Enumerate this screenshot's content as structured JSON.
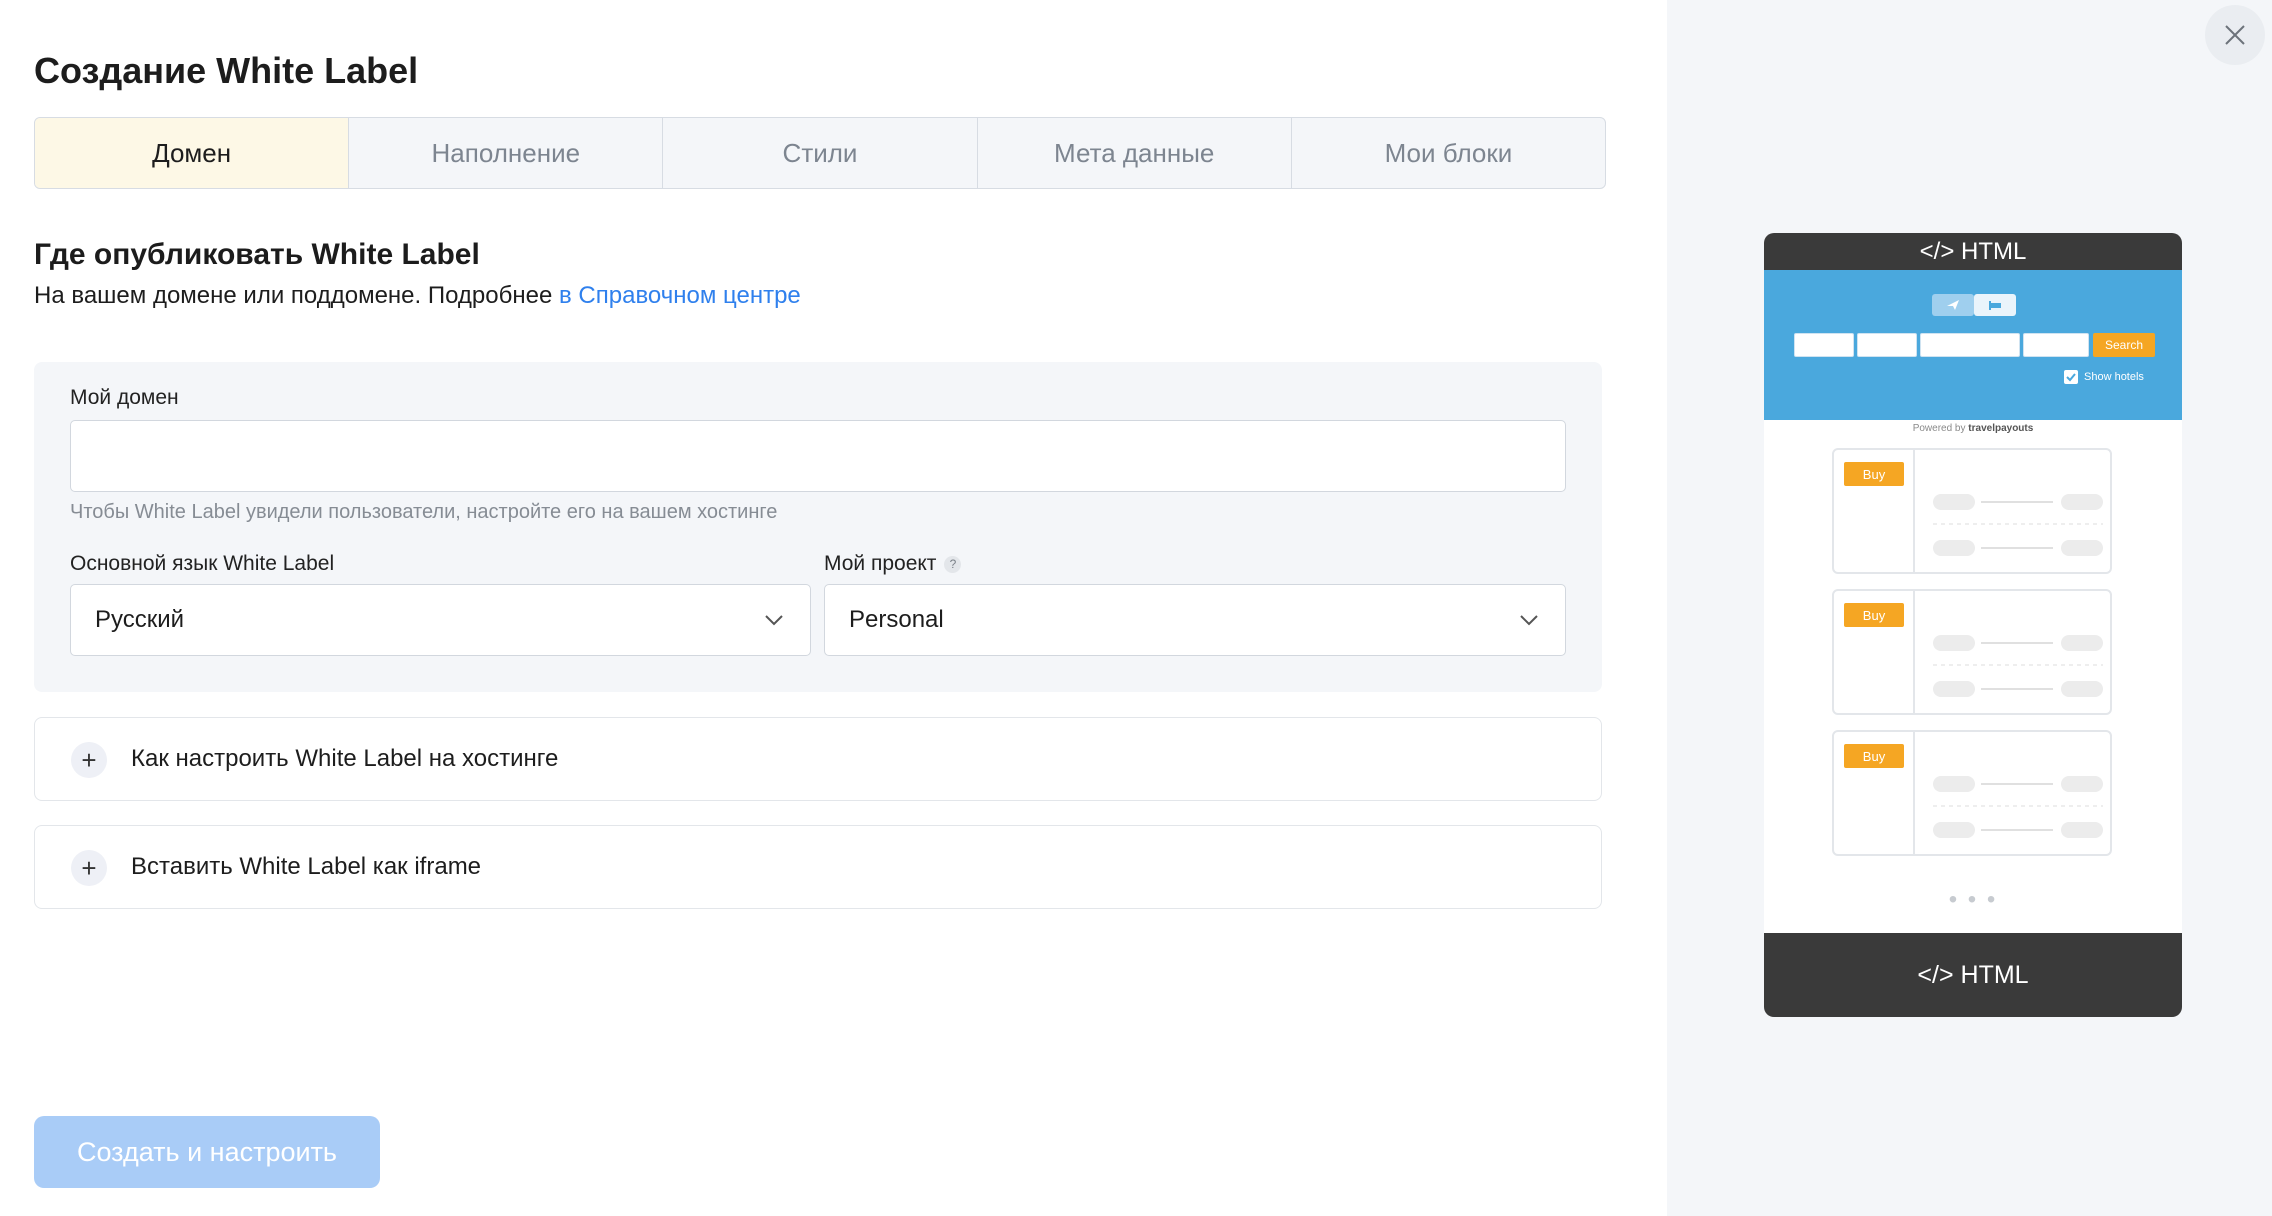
{
  "page": {
    "title": "Создание White Label",
    "tabs": [
      "Домен",
      "Наполнение",
      "Стили",
      "Мета данные",
      "Мои блоки"
    ],
    "active_tab": "Домен"
  },
  "section": {
    "title": "Где опубликовать White Label",
    "subtitle": "На вашем домене или поддомене. Подробнее",
    "link": "в Справочном центре"
  },
  "form": {
    "domain_label": "Мой домен",
    "domain_value": "",
    "domain_hint": "Чтобы White Label увидели пользователи, настройте его на вашем хостинге",
    "language_label": "Основной язык White Label",
    "language_value": "Русский",
    "project_label": "Мой проект",
    "project_help": "?",
    "project_value": "Personal"
  },
  "accordions": [
    {
      "label": "Как настроить White Label на хостинге"
    },
    {
      "label": "Вставить White Label как iframe"
    }
  ],
  "actions": {
    "create_label": "Создать и настроить"
  },
  "preview": {
    "header": "</> HTML",
    "footer": "</> HTML",
    "search_button": "Search",
    "show_hotels": "Show hotels",
    "powered_by": "Powered by",
    "powered_brand": "travelpayouts",
    "buy_label": "Buy",
    "dots": "• • •"
  },
  "colors": {
    "accent_blue": "#2f80ed",
    "button_disabled": "#a9ccf7",
    "active_tab_bg": "#fdf8e6",
    "preview_blue": "#4aa8dd",
    "preview_orange": "#f5a623",
    "preview_dark": "#3a3a3a"
  },
  "icons": [
    "close-icon",
    "chevron-down-icon",
    "plus-icon",
    "plane-icon",
    "bed-icon",
    "checkbox-icon",
    "code-icon"
  ]
}
